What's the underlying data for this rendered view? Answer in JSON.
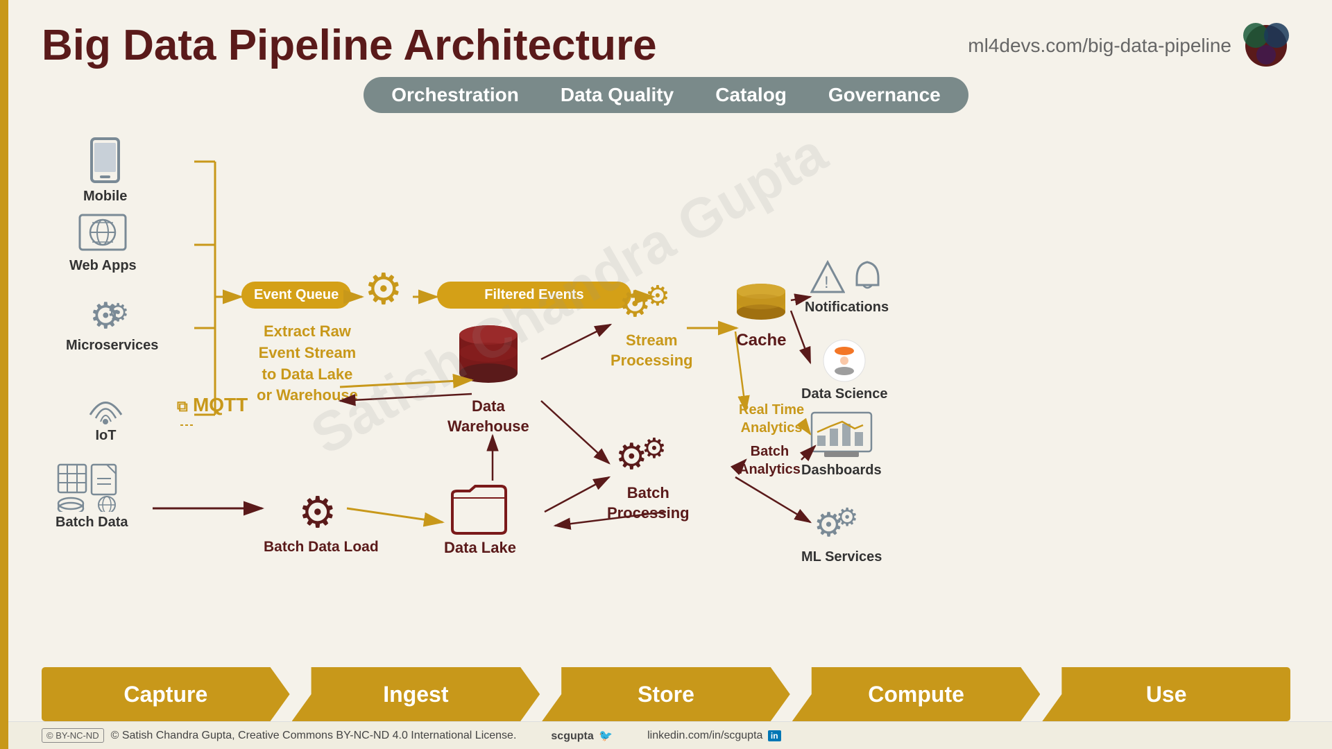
{
  "header": {
    "title": "Big Data Pipeline Architecture",
    "url": "ml4devs.com/big-data-pipeline"
  },
  "topbar": {
    "items": [
      "Orchestration",
      "Data Quality",
      "Catalog",
      "Governance"
    ]
  },
  "sources": [
    {
      "id": "mobile",
      "label": "Mobile",
      "icon": "📱"
    },
    {
      "id": "webapps",
      "label": "Web Apps",
      "icon": "🌐"
    },
    {
      "id": "microservices",
      "label": "Microservices",
      "icon": "⚙️"
    },
    {
      "id": "iot",
      "label": "IoT",
      "icon": "☁️"
    },
    {
      "id": "batchdata",
      "label": "Batch Data",
      "icon": "📋"
    }
  ],
  "nodes": {
    "eventQueue": "Event Queue",
    "filteredEvents": "Filtered Events",
    "extractText": "Extract Raw\nEvent Stream\nto Data Lake\nor Warehouse",
    "dataWarehouse": "Data\nWarehouse",
    "dataLake": "Data Lake",
    "batchDataLoad": "Batch Data Load",
    "streamProcessing": "Stream\nProcessing",
    "batchProcessing": "Batch\nProcessing",
    "cache": "Cache",
    "notifications": "Notifications",
    "dataScience": "Data Science",
    "realTimeAnalytics": "Real Time\nAnalytics",
    "batchAnalytics": "Batch\nAnalytics",
    "dashboards": "Dashboards",
    "mlServices": "ML Services",
    "mqtt": "MQTT"
  },
  "pipeline": {
    "stages": [
      "Capture",
      "Ingest",
      "Store",
      "Compute",
      "Use"
    ]
  },
  "footer": {
    "copyright": "© Satish Chandra Gupta, Creative Commons BY-NC-ND 4.0 International License.",
    "twitter": "scgupta",
    "linkedin": "linkedin.com/in/scgupta",
    "cc_badge": "BY-NC-ND"
  },
  "watermark": "Satish Chandra Gupta",
  "colors": {
    "darkRed": "#5a1a1a",
    "gold": "#c8981a",
    "gray": "#7a8a96",
    "lightBg": "#f5f2ea"
  }
}
